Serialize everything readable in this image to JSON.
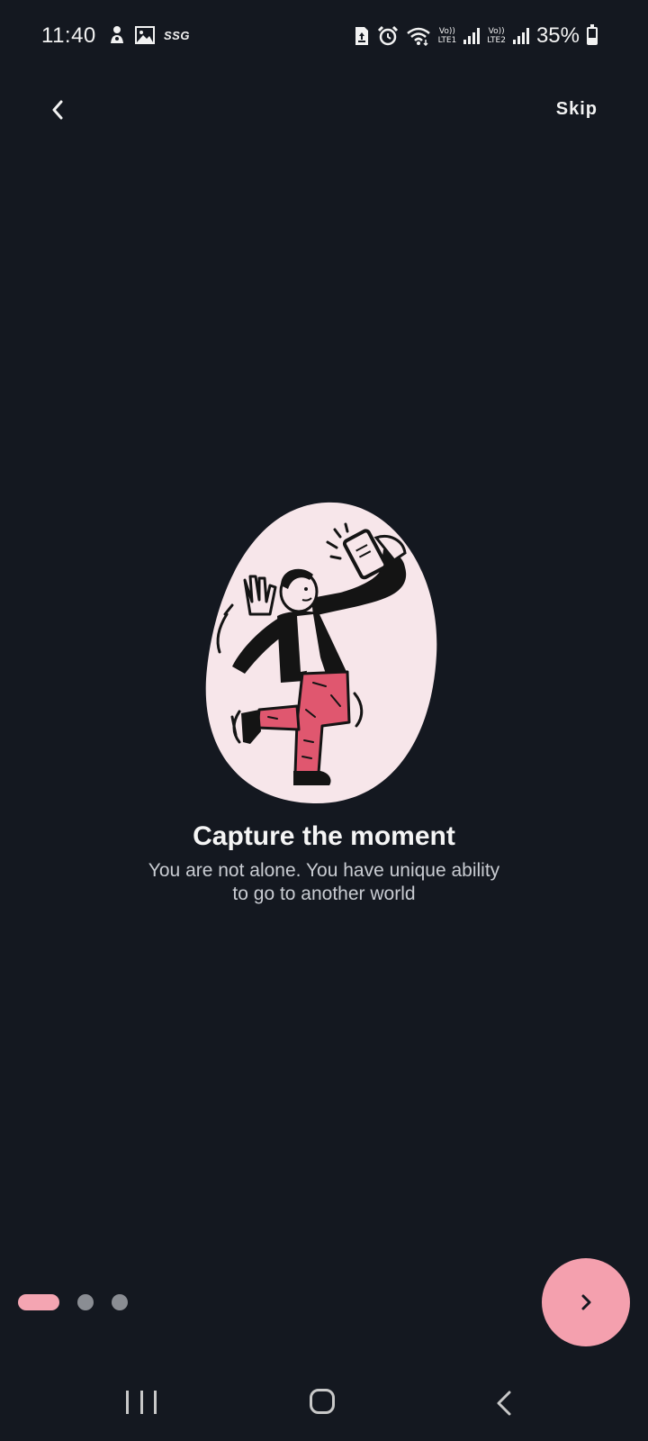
{
  "status_bar": {
    "time": "11:40",
    "carrier_badge": "SSG",
    "sim1_label_top": "Vo))",
    "sim1_label_bottom": "LTE1",
    "sim2_label_top": "Vo))",
    "sim2_label_bottom": "LTE2",
    "battery_percent": "35%",
    "battery_level": 0.35,
    "icons": [
      "notification-person-icon",
      "gallery-icon",
      "sim-icon",
      "alarm-icon",
      "wifi-icon",
      "signal-icon",
      "battery-icon"
    ]
  },
  "header": {
    "back_icon": "chevron-left-icon",
    "skip_label": "Skip"
  },
  "onboarding": {
    "illustration": "person-taking-selfie-illustration",
    "title": "Capture the moment",
    "subtitle": "You are not alone. You have unique ability to go to another world",
    "page_count": 3,
    "current_page": 1
  },
  "next_button": {
    "icon": "chevron-right-icon"
  },
  "nav_bar": {
    "icons": [
      "recents-icon",
      "home-icon",
      "back-icon"
    ]
  },
  "colors": {
    "background": "#141820",
    "accent": "#f4a0ae",
    "blob": "#f7e6ea",
    "pants": "#e0576f",
    "inactive_dot": "#8a8d93"
  }
}
